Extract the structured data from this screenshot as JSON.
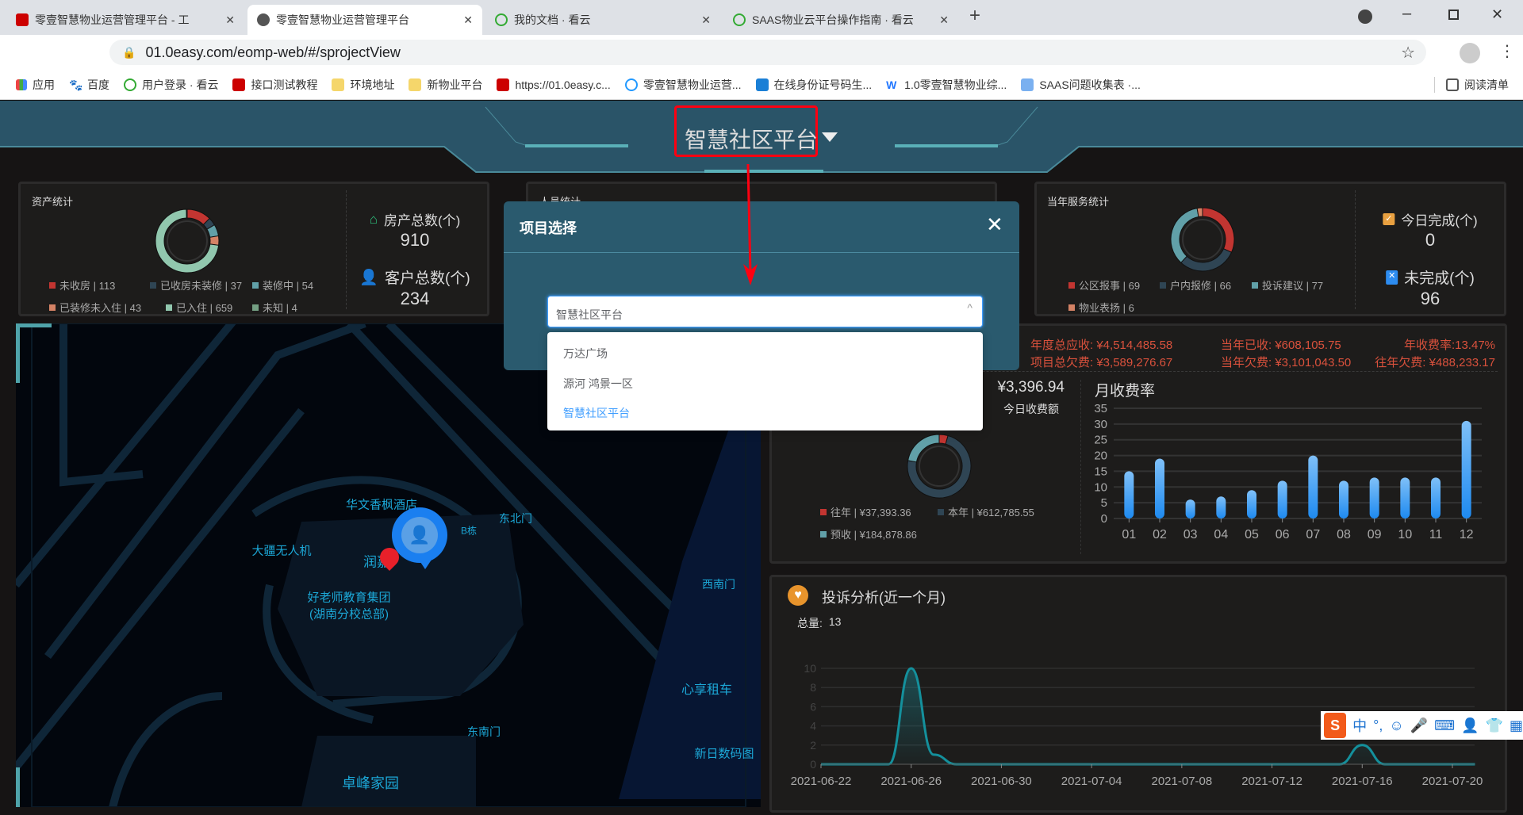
{
  "browser": {
    "tabs": [
      {
        "title": "零壹智慧物业运营管理平台 - 工",
        "active": false
      },
      {
        "title": "零壹智慧物业运营管理平台",
        "active": true
      },
      {
        "title": "我的文档 · 看云",
        "active": false
      },
      {
        "title": "SAAS物业云平台操作指南 · 看云",
        "active": false
      }
    ],
    "new_tab": "+",
    "url": "01.0easy.com/eomp-web/#/sprojectView",
    "bookmarks": [
      "应用",
      "百度",
      "用户登录 · 看云",
      "接口测试教程",
      "环境地址",
      "新物业平台",
      "https://01.0easy.c...",
      "零壹智慧物业运营...",
      "在线身份证号码生...",
      "1.0零壹智慧物业综...",
      "SAAS问题收集表 ·..."
    ],
    "reading_list": "阅读清单"
  },
  "header": {
    "title": "智慧社区平台"
  },
  "asset": {
    "title": "资产统计",
    "legend": [
      {
        "label": "未收房 | 113",
        "value": 113,
        "color": "#c23531"
      },
      {
        "label": "已收房未装修 | 37",
        "value": 37,
        "color": "#2f4554"
      },
      {
        "label": "装修中 | 54",
        "value": 54,
        "color": "#61a0a8"
      },
      {
        "label": "已装修未入住 | 43",
        "value": 43,
        "color": "#d48265"
      },
      {
        "label": "已入住 | 659",
        "value": 659,
        "color": "#91c7ae"
      },
      {
        "label": "未知 | 4",
        "value": 4,
        "color": "#749f83"
      }
    ],
    "house_label": "房产总数(个)",
    "house_value": "910",
    "customer_label": "客户总数(个)",
    "customer_value": "234"
  },
  "person": {
    "title": "人员统计"
  },
  "service": {
    "title": "当年服务统计",
    "legend": [
      {
        "label": "公区报事 | 69",
        "value": 69,
        "color": "#c23531"
      },
      {
        "label": "户内报修 | 66",
        "value": 66,
        "color": "#2f4554"
      },
      {
        "label": "投诉建议 | 77",
        "value": 77,
        "color": "#61a0a8"
      },
      {
        "label": "物业表扬 | 6",
        "value": 6,
        "color": "#d48265"
      }
    ],
    "done_label": "今日完成(个)",
    "done_value": "0",
    "undone_label": "未完成(个)",
    "undone_value": "96"
  },
  "fee": {
    "annual_receivable": "年度总应收: ¥4,514,485.58",
    "year_received": "当年已收: ¥608,105.75",
    "year_rate": "年收费率:13.47%",
    "total_arrears": "项目总欠费: ¥3,589,276.67",
    "year_arrears": "当年欠费: ¥3,101,043.50",
    "past_arrears": "往年欠费: ¥488,233.17",
    "today_amount": "¥3,396.94",
    "today_label": "今日收费额",
    "legend": [
      {
        "label": "往年 | ¥37,393.36",
        "value": 37393.36,
        "color": "#c23531"
      },
      {
        "label": "本年 | ¥612,785.55",
        "value": 612785.55,
        "color": "#2f4554"
      },
      {
        "label": "预收 | ¥184,878.86",
        "value": 184878.86,
        "color": "#61a0a8"
      }
    ]
  },
  "complaint": {
    "title": "投诉分析(近一个月)",
    "total_label": "总量:",
    "total_value": "13"
  },
  "map": {
    "labels": [
      "华文香枫酒店",
      "东北门",
      "B栋",
      "大疆无人机",
      "润嘉",
      "好老师教育集团",
      "(湖南分校总部)",
      "西南门",
      "心享租车",
      "东南门",
      "新日数码图",
      "卓峰家园"
    ]
  },
  "modal": {
    "title": "项目选择",
    "close": "✕",
    "selected": "智慧社区平台",
    "options": [
      "万达广场",
      "源河 鸿景一区",
      "智慧社区平台"
    ]
  },
  "ime": {
    "lang": "中",
    "punct": "°,"
  },
  "chart_data": [
    {
      "type": "bar",
      "title": "月收费率",
      "categories": [
        "01",
        "02",
        "03",
        "04",
        "05",
        "06",
        "07",
        "08",
        "09",
        "10",
        "11",
        "12"
      ],
      "values": [
        15,
        19,
        6,
        7,
        9,
        12,
        20,
        12,
        13,
        13,
        13,
        31
      ],
      "ylim": [
        0,
        35
      ],
      "yticks": [
        "0",
        "5",
        "10",
        "15",
        "20",
        "25",
        "30",
        "35"
      ],
      "grid": true
    },
    {
      "type": "area",
      "title": "投诉分析(近一个月)",
      "x_start": "2021-06-22",
      "days": 29,
      "xticks": [
        "2021-06-22",
        "2021-06-26",
        "2021-06-30",
        "2021-07-04",
        "2021-07-08",
        "2021-07-12",
        "2021-07-16",
        "2021-07-20"
      ],
      "points": [
        {
          "day": 4,
          "value": 10
        },
        {
          "day": 5,
          "value": 1
        },
        {
          "day": 24,
          "value": 2
        }
      ],
      "ylim": [
        0,
        10
      ],
      "yticks": [
        "0",
        "2",
        "4",
        "6",
        "8",
        "10"
      ],
      "grid": true
    }
  ]
}
